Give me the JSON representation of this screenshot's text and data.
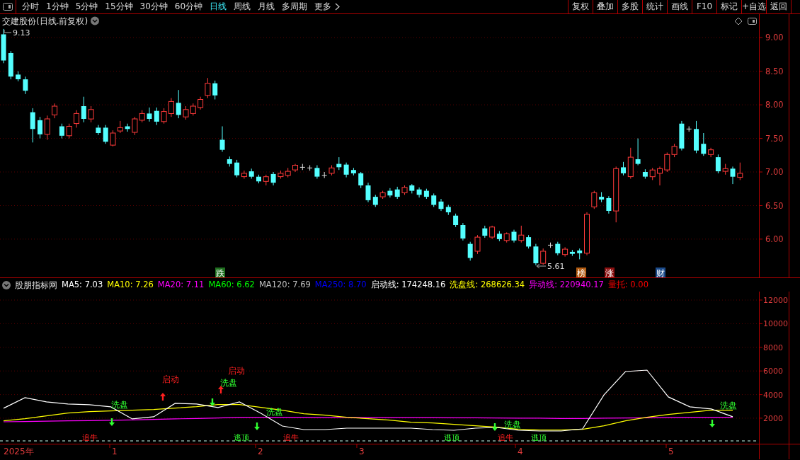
{
  "toolbar": {
    "periods": [
      {
        "label": "分时",
        "selected": false
      },
      {
        "label": "1分钟",
        "selected": false
      },
      {
        "label": "5分钟",
        "selected": false
      },
      {
        "label": "15分钟",
        "selected": false
      },
      {
        "label": "30分钟",
        "selected": false
      },
      {
        "label": "60分钟",
        "selected": false
      },
      {
        "label": "日线",
        "selected": true
      },
      {
        "label": "周线",
        "selected": false
      },
      {
        "label": "月线",
        "selected": false
      },
      {
        "label": "多周期",
        "selected": false
      },
      {
        "label": "更多",
        "selected": false
      }
    ],
    "buttons": [
      "复权",
      "叠加",
      "多股",
      "统计",
      "画线",
      "F10",
      "标记",
      "+自选",
      "返回"
    ]
  },
  "main_chart": {
    "title": "交建股份(日线.前复权)",
    "high_label": "9.13",
    "low_label": "5.61",
    "chart_data": {
      "type": "candlestick",
      "ylim": [
        5.43,
        9.35
      ],
      "grid": true,
      "yticks": [
        {
          "value": 9,
          "label": "9.00"
        },
        {
          "value": 8.5,
          "label": "8.50"
        },
        {
          "value": 8,
          "label": "8.00"
        },
        {
          "value": 7.5,
          "label": "7.50"
        },
        {
          "value": 7,
          "label": "7.00"
        },
        {
          "value": 6.5,
          "label": "6.50"
        },
        {
          "value": 6,
          "label": "6.00"
        }
      ],
      "ohlc": [
        [
          9.05,
          9.13,
          8.62,
          8.66
        ],
        [
          8.77,
          8.8,
          8.38,
          8.42
        ],
        [
          8.45,
          8.5,
          8.35,
          8.38
        ],
        [
          8.38,
          8.42,
          8.16,
          8.21
        ],
        [
          7.89,
          7.95,
          7.44,
          7.64
        ],
        [
          7.77,
          7.82,
          7.5,
          7.56
        ],
        [
          7.56,
          7.84,
          7.48,
          7.79
        ],
        [
          7.85,
          8.02,
          7.8,
          7.98
        ],
        [
          7.68,
          7.72,
          7.5,
          7.54
        ],
        [
          7.54,
          7.72,
          7.5,
          7.68
        ],
        [
          7.72,
          7.92,
          7.66,
          7.87
        ],
        [
          7.98,
          8.12,
          7.74,
          7.79
        ],
        [
          7.79,
          7.98,
          7.74,
          7.93
        ],
        [
          7.66,
          7.7,
          7.55,
          7.58
        ],
        [
          7.66,
          7.7,
          7.42,
          7.45
        ],
        [
          7.4,
          7.62,
          7.38,
          7.58
        ],
        [
          7.61,
          7.76,
          7.58,
          7.66
        ],
        [
          7.68,
          7.72,
          7.6,
          7.64
        ],
        [
          7.59,
          7.82,
          7.55,
          7.79
        ],
        [
          7.77,
          7.92,
          7.74,
          7.87
        ],
        [
          7.87,
          7.96,
          7.75,
          7.79
        ],
        [
          7.91,
          7.96,
          7.7,
          7.75
        ],
        [
          7.75,
          7.95,
          7.72,
          7.9
        ],
        [
          7.87,
          8.1,
          7.82,
          8.05
        ],
        [
          8.03,
          8.22,
          7.8,
          7.85
        ],
        [
          7.82,
          7.98,
          7.78,
          7.93
        ],
        [
          7.87,
          8.02,
          7.84,
          7.98
        ],
        [
          7.96,
          8.12,
          7.93,
          8.08
        ],
        [
          8.14,
          8.4,
          8.1,
          8.32
        ],
        [
          8.32,
          8.36,
          8.08,
          8.14
        ],
        [
          7.48,
          7.68,
          7.3,
          7.33
        ],
        [
          7.19,
          7.23,
          7.08,
          7.12
        ],
        [
          7.14,
          7.18,
          6.92,
          6.95
        ],
        [
          6.93,
          7.02,
          6.9,
          6.98
        ],
        [
          7.01,
          7.05,
          6.9,
          6.93
        ],
        [
          6.93,
          6.96,
          6.83,
          6.86
        ],
        [
          6.86,
          6.96,
          6.8,
          6.93
        ],
        [
          6.97,
          7.0,
          6.8,
          6.84
        ],
        [
          6.93,
          7.02,
          6.9,
          6.98
        ],
        [
          6.95,
          7.06,
          6.92,
          7.01
        ],
        [
          7.03,
          7.12,
          7.0,
          7.1
        ],
        [
          7.07,
          7.12,
          7.03,
          7.07
        ],
        [
          7.06,
          7.1,
          7.02,
          7.06
        ],
        [
          7.06,
          7.1,
          6.9,
          6.93
        ],
        [
          6.95,
          7.0,
          6.91,
          6.95
        ],
        [
          6.98,
          7.1,
          6.95,
          7.06
        ],
        [
          7.12,
          7.22,
          7.03,
          7.07
        ],
        [
          7.11,
          7.14,
          6.92,
          6.96
        ],
        [
          7.03,
          7.06,
          6.95,
          6.98
        ],
        [
          6.98,
          7.0,
          6.76,
          6.8
        ],
        [
          6.8,
          6.84,
          6.55,
          6.58
        ],
        [
          6.63,
          6.66,
          6.48,
          6.51
        ],
        [
          6.63,
          6.72,
          6.6,
          6.69
        ],
        [
          6.72,
          6.76,
          6.62,
          6.65
        ],
        [
          6.74,
          6.78,
          6.6,
          6.63
        ],
        [
          6.69,
          6.8,
          6.66,
          6.77
        ],
        [
          6.8,
          6.82,
          6.68,
          6.72
        ],
        [
          6.74,
          6.77,
          6.62,
          6.66
        ],
        [
          6.72,
          6.75,
          6.6,
          6.63
        ],
        [
          6.65,
          6.68,
          6.48,
          6.51
        ],
        [
          6.56,
          6.6,
          6.42,
          6.45
        ],
        [
          6.48,
          6.51,
          6.36,
          6.4
        ],
        [
          6.35,
          6.38,
          6.18,
          6.21
        ],
        [
          6.21,
          6.24,
          5.98,
          6.01
        ],
        [
          5.93,
          5.96,
          5.68,
          5.72
        ],
        [
          5.82,
          6.06,
          5.78,
          6.03
        ],
        [
          6.16,
          6.2,
          6.02,
          6.05
        ],
        [
          6.03,
          6.2,
          6.0,
          6.18
        ],
        [
          6.08,
          6.12,
          5.97,
          6.0
        ],
        [
          5.98,
          6.1,
          5.95,
          6.08
        ],
        [
          6.11,
          6.14,
          5.95,
          5.98
        ],
        [
          5.98,
          6.2,
          5.95,
          6.06
        ],
        [
          6.03,
          6.06,
          5.86,
          5.89
        ],
        [
          5.89,
          5.93,
          5.61,
          5.64
        ],
        [
          5.64,
          5.86,
          5.62,
          5.82
        ],
        [
          5.91,
          5.95,
          5.87,
          5.91
        ],
        [
          5.93,
          5.96,
          5.76,
          5.79
        ],
        [
          5.77,
          5.88,
          5.74,
          5.85
        ],
        [
          5.81,
          5.84,
          5.75,
          5.78
        ],
        [
          5.83,
          5.86,
          5.7,
          5.79
        ],
        [
          5.79,
          6.4,
          5.76,
          6.37
        ],
        [
          6.48,
          6.72,
          6.45,
          6.69
        ],
        [
          6.63,
          6.7,
          6.55,
          6.59
        ],
        [
          6.61,
          6.64,
          6.38,
          6.42
        ],
        [
          6.42,
          7.08,
          6.25,
          7.05
        ],
        [
          7.07,
          7.15,
          6.95,
          6.98
        ],
        [
          6.93,
          7.36,
          6.9,
          7.22
        ],
        [
          7.19,
          7.5,
          7.1,
          7.12
        ],
        [
          7.0,
          7.04,
          6.9,
          6.93
        ],
        [
          6.93,
          7.06,
          6.88,
          7.03
        ],
        [
          6.98,
          7.08,
          6.8,
          7.05
        ],
        [
          7.03,
          7.29,
          7.0,
          7.26
        ],
        [
          7.26,
          7.42,
          7.22,
          7.38
        ],
        [
          7.72,
          7.76,
          7.32,
          7.35
        ],
        [
          7.64,
          7.68,
          7.6,
          7.64
        ],
        [
          7.64,
          7.76,
          7.28,
          7.32
        ],
        [
          7.42,
          7.58,
          7.24,
          7.27
        ],
        [
          7.26,
          7.36,
          7.22,
          7.33
        ],
        [
          7.22,
          7.26,
          6.98,
          7.01
        ],
        [
          7.01,
          7.12,
          6.96,
          7.05
        ],
        [
          7.05,
          7.08,
          6.82,
          6.93
        ],
        [
          6.92,
          7.14,
          6.88,
          6.98
        ]
      ]
    },
    "markers": [
      {
        "text": "跌",
        "color": "#1e6e1e"
      },
      {
        "text": "榜",
        "color": "#b05a10"
      },
      {
        "text": "涨",
        "color": "#8a1010"
      },
      {
        "text": "财",
        "color": "#1a4a8a"
      }
    ]
  },
  "indicator": {
    "name": "股朋指标网",
    "values": [
      {
        "label": "MA5: 7.03",
        "color": "#ffffff"
      },
      {
        "label": "MA10: 7.26",
        "color": "#ffff00"
      },
      {
        "label": "MA20: 7.11",
        "color": "#ff00ff"
      },
      {
        "label": "MA60: 6.62",
        "color": "#00ff00"
      },
      {
        "label": "MA120: 7.69",
        "color": "#c0c0c0"
      },
      {
        "label": "MA250: 8.70",
        "color": "#0000ff"
      },
      {
        "label": "启动线: 174248.16",
        "color": "#ffffff"
      },
      {
        "label": "洗盘线: 268626.34",
        "color": "#ffff00"
      },
      {
        "label": "异动线: 220940.17",
        "color": "#ff00ff"
      },
      {
        "label": "量托: 0.00",
        "color": "#ff0000"
      }
    ],
    "chart_data": {
      "type": "line",
      "ylim": [
        -160,
        12720
      ],
      "grid": true,
      "ref_lines": [
        {
          "axis": "y",
          "value": 80
        }
      ],
      "yticks": [
        12000,
        10000,
        8000,
        6000,
        4000,
        2000
      ],
      "series": [
        {
          "color": "#ffffff",
          "values": [
            2840,
            3740,
            3380,
            3200,
            3140,
            2960,
            1940,
            2120,
            3260,
            3200,
            2900,
            3380,
            2420,
            1340,
            1040,
            1040,
            1160,
            1160,
            1160,
            1160,
            1040,
            980,
            1160,
            1220,
            980,
            920,
            920,
            1100,
            3980,
            5950,
            6070,
            3800,
            2960,
            2780,
            2120
          ]
        },
        {
          "color": "#ffff00",
          "values": [
            1780,
            1960,
            2200,
            2440,
            2560,
            2620,
            2680,
            2740,
            2860,
            2980,
            3160,
            3160,
            2920,
            2680,
            2380,
            2260,
            2080,
            1960,
            1840,
            1660,
            1600,
            1480,
            1360,
            1240,
            1060,
            1000,
            1000,
            1060,
            1360,
            1780,
            2080,
            2320,
            2500,
            2680,
            2680
          ]
        },
        {
          "color": "#ff00ff",
          "values": [
            1700,
            1720,
            1750,
            1780,
            1800,
            1830,
            1860,
            1900,
            1940,
            1980,
            2020,
            2080,
            2080,
            2080,
            2080,
            2060,
            2060,
            2060,
            2060,
            2060,
            2060,
            2040,
            2040,
            2020,
            2000,
            2000,
            1980,
            1980,
            2000,
            2020,
            2040,
            2060,
            2080,
            2080,
            2080
          ]
        }
      ]
    },
    "signals": [
      {
        "kind": "wash",
        "text": "洗盘"
      },
      {
        "kind": "start",
        "text": "启动"
      },
      {
        "kind": "wash",
        "text": "洗盘"
      },
      {
        "kind": "start",
        "text": "启动"
      },
      {
        "kind": "wash",
        "text": "洗盘"
      },
      {
        "kind": "wash",
        "text": "洗盘"
      },
      {
        "kind": "wash",
        "text": "洗盘"
      }
    ],
    "bottom_signals": [
      {
        "kind": "chase",
        "text": "追牛"
      },
      {
        "kind": "top",
        "text": "逃顶"
      },
      {
        "kind": "chase",
        "text": "追牛"
      },
      {
        "kind": "top",
        "text": "逃顶"
      },
      {
        "kind": "chase",
        "text": "追牛"
      },
      {
        "kind": "top",
        "text": "逃顶"
      }
    ]
  },
  "date_axis": [
    "2025年",
    "1",
    "2",
    "3",
    "4",
    "5"
  ]
}
